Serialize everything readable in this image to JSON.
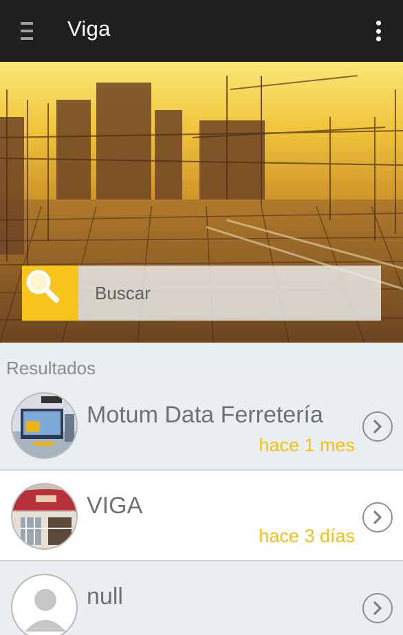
{
  "appbar": {
    "title": "Viga",
    "menu_icon": "hamburger-menu-icon",
    "overflow_icon": "more-vertical-icon"
  },
  "hero": {
    "image": "construction-site-banner",
    "search": {
      "placeholder": "Buscar",
      "icon": "search-icon"
    }
  },
  "results": {
    "heading": "Resultados",
    "items": [
      {
        "title": "Motum Data Ferretería",
        "time": "hace 1 mes",
        "avatar": "store-avatar-monitor"
      },
      {
        "title": "VIGA",
        "time": "hace 3 días",
        "avatar": "store-avatar-storefront"
      },
      {
        "title": "null",
        "time": "",
        "avatar": "default-user-avatar"
      }
    ]
  },
  "colors": {
    "appbar": "#1f1f1f",
    "accent": "#f7c51b",
    "time_text": "#f5c00f",
    "row_grey": "#e9eef0",
    "row_white": "#ffffff"
  }
}
